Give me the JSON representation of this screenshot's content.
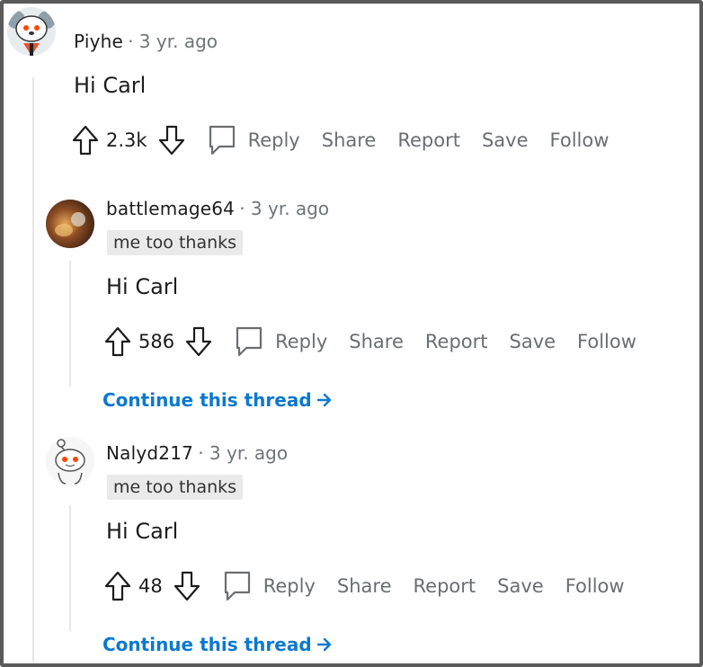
{
  "comments": [
    {
      "author": "Piyhe",
      "meta": "· 3 yr. ago",
      "flair": "",
      "body": "Hi Carl",
      "score": "2.3k",
      "avatar_icon": "koala-snoo-avatar"
    },
    {
      "author": "battlemage64",
      "meta": "· 3 yr. ago",
      "flair": "me too thanks",
      "body": "Hi Carl",
      "score": "586",
      "avatar_icon": "photo-avatar",
      "continue_label": "Continue this thread"
    },
    {
      "author": "Nalyd217",
      "meta": "· 3 yr. ago",
      "flair": "me too thanks",
      "body": "Hi Carl",
      "score": "48",
      "avatar_icon": "default-snoo-avatar",
      "continue_label": "Continue this thread"
    }
  ],
  "actions": {
    "reply": "Reply",
    "share": "Share",
    "report": "Report",
    "save": "Save",
    "follow": "Follow"
  },
  "colors": {
    "link": "#0b79d0",
    "muted": "#6f7478",
    "flair_bg": "#eaeaea",
    "frame": "#5a5a5a"
  }
}
